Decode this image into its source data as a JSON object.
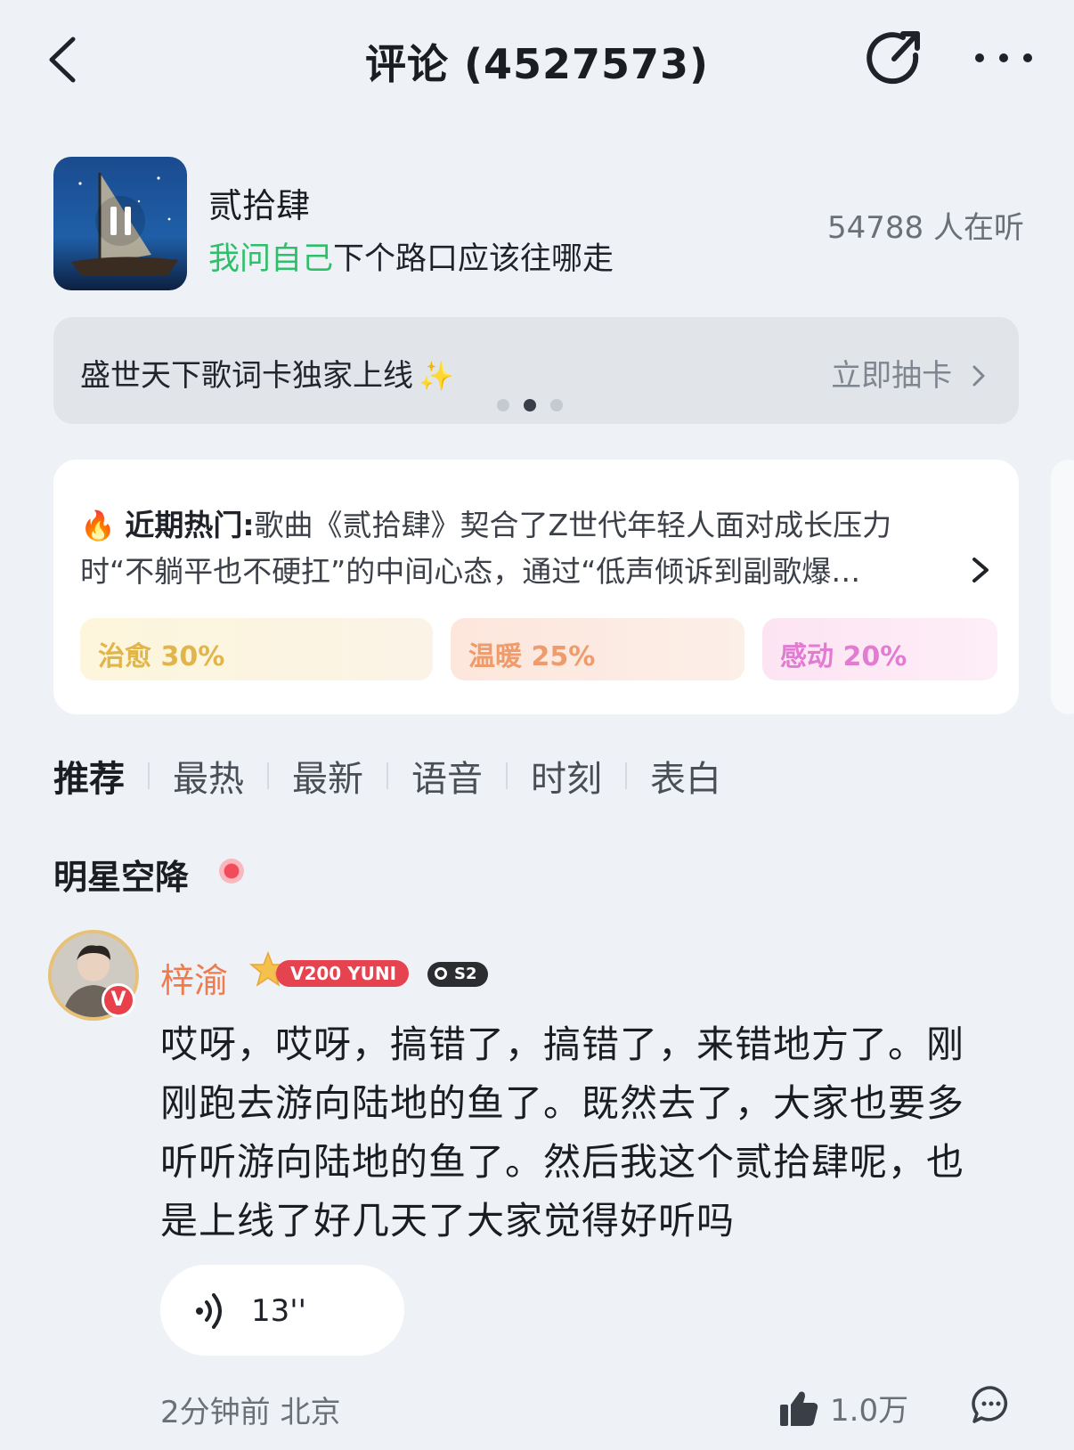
{
  "header": {
    "title": "评论 (4527573)"
  },
  "song": {
    "title": "贰拾肆",
    "lyric_highlight": "我问自己",
    "lyric_rest": "下个路口应该往哪走",
    "listeners": "54788 人在听"
  },
  "banner": {
    "text": "盛世天下歌词卡独家上线",
    "cta": "立即抽卡"
  },
  "hot": {
    "label": "近期热门:",
    "text": "歌曲《贰拾肆》契合了Z世代年轻人面对成长压力时“不躺平也不硬扛”的中间心态，通过“低声倾诉到副歌爆…",
    "tags": [
      {
        "label": "治愈 30%"
      },
      {
        "label": "温暖 25%"
      },
      {
        "label": "感动 20%"
      }
    ]
  },
  "tabs": [
    "推荐",
    "最热",
    "最新",
    "语音",
    "时刻",
    "表白"
  ],
  "section_title": "明星空降",
  "comment": {
    "username": "梓渝",
    "vip_label": "V200 YUNI",
    "badge_label": "S2",
    "text": "哎呀，哎呀，搞错了，搞错了，来错地方了。刚刚跑去游向陆地的鱼了。既然去了，大家也要多听听游向陆地的鱼了。然后我这个贰拾肆呢，也是上线了好几天了大家觉得好听吗",
    "voice_length": "13''",
    "meta": "2分钟前 北京",
    "likes": "1.0万"
  },
  "colors": {
    "lyric_highlight": "#2fbe6a",
    "username": "#ef7a4e",
    "vip": "#e54350"
  }
}
